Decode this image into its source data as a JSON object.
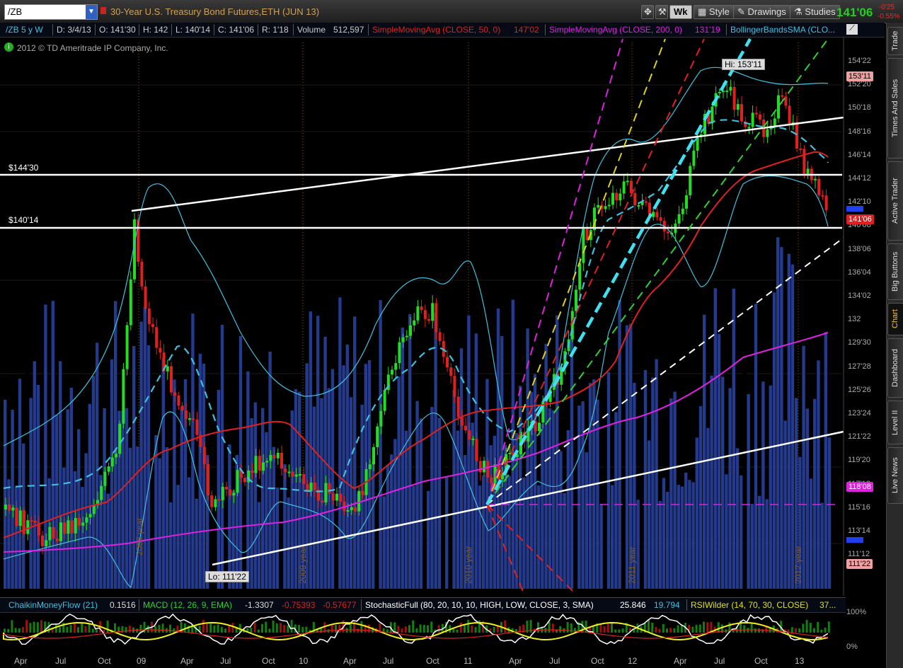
{
  "toolbar": {
    "symbol": "/ZB",
    "title": "30-Year U.S. Treasury Bond Futures,ETH (JUN 13)",
    "period_button": "Wk",
    "style_label": "Style",
    "drawings_label": "Drawings",
    "studies_label": "Studies",
    "last_price": "141'06",
    "change": "-0'25",
    "change_pct": "-0.55%"
  },
  "infobar": {
    "symbol_period": "/ZB 5 y W",
    "date": "D: 3/4/13",
    "open": "O: 141'30",
    "high": "H: 142",
    "low": "L: 140'14",
    "close": "C: 141'06",
    "range": "R: 1'18",
    "volume_label": "Volume",
    "volume": "512,597",
    "sma50_label": "SimpleMovingAvg (CLOSE, 50, 0)",
    "sma50_value": "147'02",
    "sma200_label": "SimpleMovingAvg (CLOSE, 200, 0)",
    "sma200_value": "131'19",
    "bb_label": "BollingerBandsSMA (CLO..."
  },
  "copyright": "2012 © TD Ameritrade IP Company, Inc.",
  "annotations": {
    "level1": "$144'30",
    "level2": "$140'14",
    "hi": "Hi: 153'11",
    "lo": "Lo: 111'22"
  },
  "year_markers": [
    "2008 year",
    "2009 year",
    "2010 year",
    "2011 year",
    "2012 year"
  ],
  "y_axis_ticks": [
    "154'22",
    "152'20",
    "150'18",
    "148'16",
    "146'14",
    "144'12",
    "142'10",
    "140'08",
    "138'06",
    "136'04",
    "134'02",
    "132",
    "129'30",
    "127'28",
    "125'26",
    "123'24",
    "121'22",
    "119'20",
    "117'18",
    "115'16",
    "113'14",
    "111'12"
  ],
  "price_tags": {
    "hi": "153'11",
    "last": "141'06",
    "sma200": "118'08",
    "lo": "111'22"
  },
  "lower_panel": {
    "cmf_label": "ChaikinMoneyFlow (21)",
    "cmf_value": "0.1516",
    "macd_label": "MACD (12, 26, 9, EMA)",
    "macd_v1": "-1.3307",
    "macd_v2": "-0.75393",
    "macd_v3": "-0.57677",
    "stoch_label": "StochasticFull (80, 20, 10, 10, HIGH, LOW, CLOSE, 3, SMA)",
    "stoch_v1": "25.846",
    "stoch_v2": "19.794",
    "rsi_label": "RSIWilder (14, 70, 30, CLOSE)",
    "rsi_value": "37...",
    "scale_top": "100%",
    "scale_bottom": "0%"
  },
  "x_axis_labels": [
    "Apr",
    "Jul",
    "Oct",
    "09",
    "Apr",
    "Jul",
    "Oct",
    "10",
    "Apr",
    "Jul",
    "Oct",
    "11",
    "Apr",
    "Jul",
    "Oct",
    "12",
    "Apr",
    "Jul",
    "Oct",
    "13"
  ],
  "side_tabs": [
    "Trade",
    "Times And Sales",
    "Active Trader",
    "Big Buttons",
    "Chart",
    "Dashboard",
    "Level II",
    "Live News"
  ],
  "colors": {
    "up": "#22dd22",
    "down": "#e02020",
    "sma50": "#e02020",
    "sma200": "#e020e0",
    "bollinger": "#40c0e0",
    "volume": "#243a8c",
    "price_label": "#d0a050"
  }
}
